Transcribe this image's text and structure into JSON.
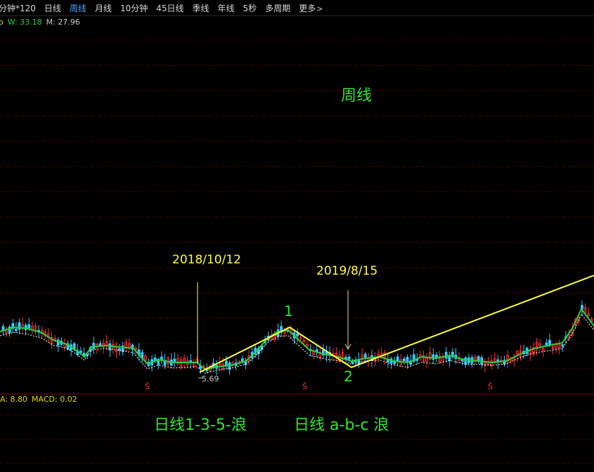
{
  "toolbar": {
    "items": [
      {
        "label": "分钟*120",
        "active": false
      },
      {
        "label": "日线",
        "active": false
      },
      {
        "label": "周线",
        "active": true
      },
      {
        "label": "月线",
        "active": false
      },
      {
        "label": "10分钟",
        "active": false
      },
      {
        "label": "45日线",
        "active": false
      },
      {
        "label": "季线",
        "active": false
      },
      {
        "label": "年线",
        "active": false
      },
      {
        "label": "5秒",
        "active": false
      },
      {
        "label": "多周期",
        "active": false
      },
      {
        "label": "更多",
        "active": false
      }
    ],
    "more_icon": "chevron-right-icon"
  },
  "main_indicators": {
    "prefix": "o",
    "w_label": "W: 33.18",
    "m_label": "M: 27.96"
  },
  "sub_indicators": {
    "prefix": "A: 8.80",
    "macd_label": "MACD: 0.02"
  },
  "annotations": {
    "period_title": "周线",
    "date1": "2018/10/12",
    "date2": "2019/8/15",
    "wave1": "1",
    "wave2": "2",
    "low_price": "5.69",
    "daily_wave_135": "日线1-3-5-浪",
    "daily_wave_abc": "日线 a-b-c 浪",
    "marker_glyph": "Ŝ"
  },
  "colors": {
    "background": "#000000",
    "grid": "#8b0000",
    "ma_line": "#2ecc40",
    "ma_dashed": "#ffffff",
    "candle_up": "#ff3030",
    "candle_down": "#33ccff",
    "annotation_line": "#ffff40",
    "annotation_text_yellow": "#ffff40",
    "annotation_text_green": "#2ee62e",
    "active_tab": "#4aa3ff",
    "marker": "#ff3030"
  }
}
